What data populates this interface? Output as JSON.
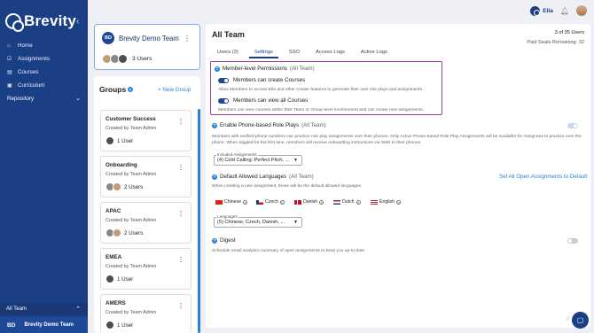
{
  "brand": {
    "name": "Brevity"
  },
  "nav": [
    {
      "label": "Home",
      "icon": "home-icon"
    },
    {
      "label": "Assignments",
      "icon": "assignments-icon"
    },
    {
      "label": "Courses",
      "icon": "courses-icon"
    },
    {
      "label": "Curriculum",
      "icon": "curriculum-icon"
    }
  ],
  "repository": {
    "label": "Repository"
  },
  "sidebar_bottom": {
    "team_switch": "All Team",
    "badge": "BD",
    "team_name": "Brevity Demo Team"
  },
  "topbar": {
    "user": "Ella"
  },
  "team_card": {
    "badge": "BD",
    "title": "Brevity Demo Team",
    "users": "3 Users"
  },
  "groups": {
    "title": "Groups",
    "new_group": "+ New Group",
    "items": [
      {
        "name": "Customer Success",
        "by": "Created by Team Admin",
        "users": "1 User"
      },
      {
        "name": "Onboarding",
        "by": "Created by Team Admin",
        "users": "2 Users"
      },
      {
        "name": "APAC",
        "by": "Created by Team Admin",
        "users": "2 Users"
      },
      {
        "name": "EMEA",
        "by": "Created by Team Admin",
        "users": "1 User"
      },
      {
        "name": "AMERS",
        "by": "Created by Team Admin",
        "users": "1 User"
      }
    ]
  },
  "main": {
    "title": "All Team",
    "users_count": "3 of 35 Users",
    "seats": "Paid Seats Remaining:  32",
    "tabs": [
      "Users (3)",
      "Settings",
      "SSO",
      "Access Logs",
      "Active Logs"
    ],
    "member_perms": {
      "heading": "Member-level Permissions",
      "heading_note": "(All Team)",
      "create_label": "Members can create Courses",
      "create_desc": "Allow Members to access Ella and other Create features to generate their own role plays and assignments.",
      "view_label": "Members can view all Courses",
      "view_desc": "Members can view courses within their Team or Group-level environment and can create new assignments."
    },
    "phone": {
      "heading": "Enable Phone-based Role Plays",
      "heading_note": "(All Team)",
      "desc": "Members with verified phone numbers can practice role play assignments over their phones. Only Active Phone-based Role Play Assignments will be available for Assignees to practice over the phone. When toggled for the first time, members will receive onboarding instructions via SMS to their phones.",
      "select_label": "Included Assignments",
      "select_value": "(4)  Cold Calling: Perfect Pitch, ..."
    },
    "languages": {
      "heading": "Default Allowed Languages",
      "heading_note": "(All Team)",
      "link": "Set All Open Assignments to Default",
      "desc": "When creating a new assignment, these will be the default allowed languages.",
      "chips": [
        "Chinese",
        "Czech",
        "Danish",
        "Dutch",
        "English"
      ],
      "select_label": "Languages",
      "select_value": "(5)  Chinese,  Czech,  Danish, ..."
    },
    "digest": {
      "heading": "Digest",
      "desc": "Schedule email analytics summary of open assignments to keep you up-to-date."
    }
  },
  "colors": {
    "sidebar": "#1b3f84",
    "accent": "#2a82d4",
    "highlight_border": "#9d3da8"
  }
}
